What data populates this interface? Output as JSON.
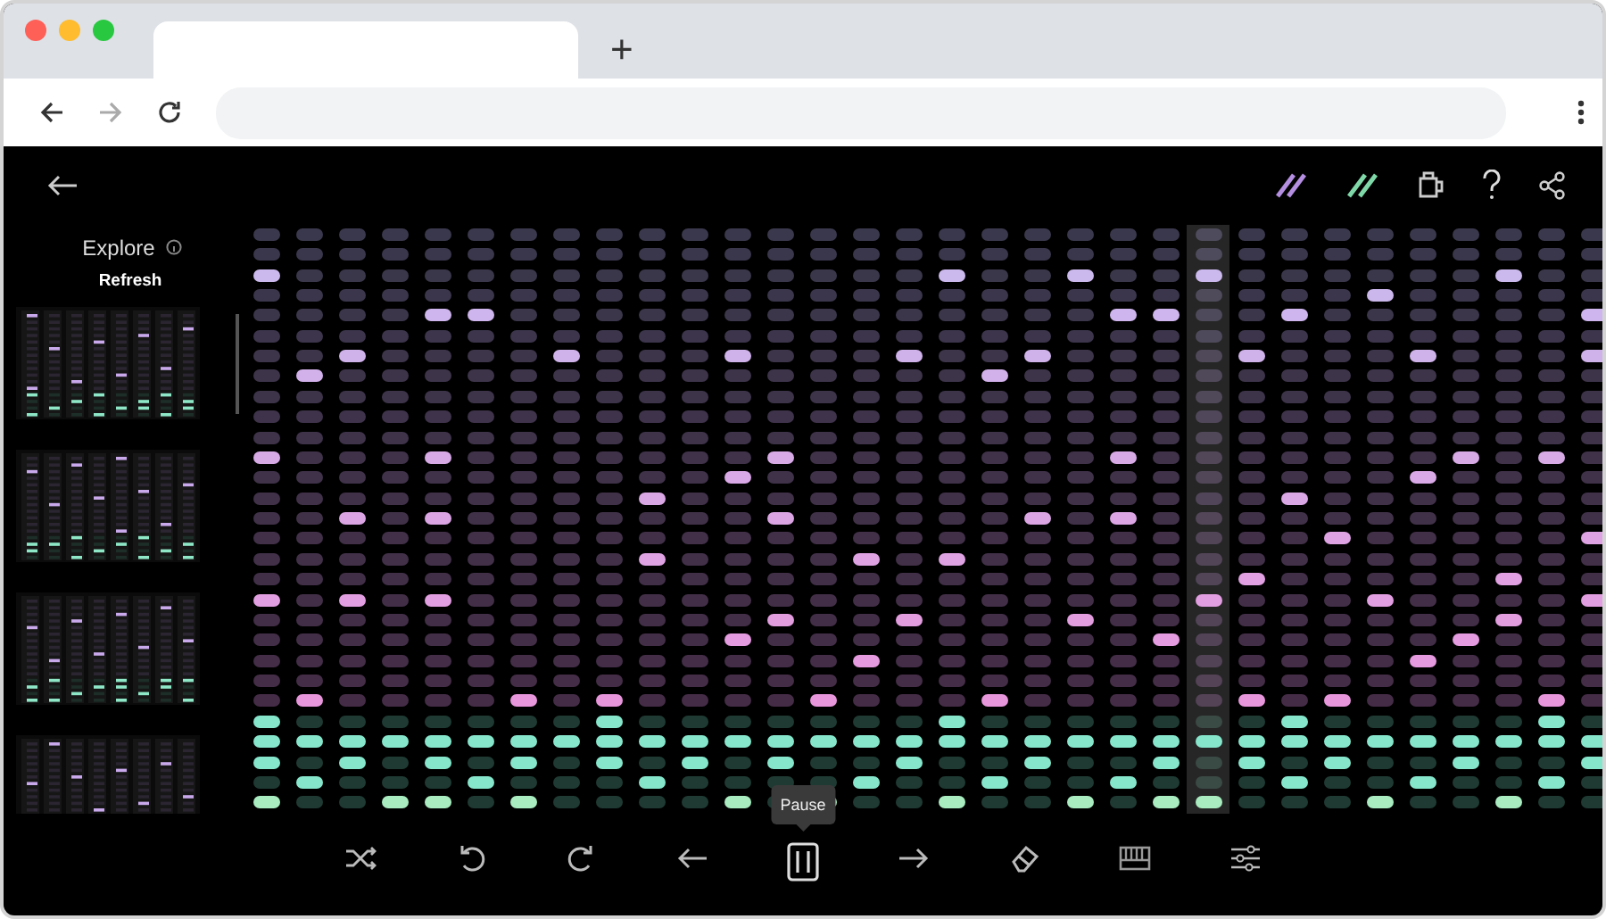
{
  "browser": {
    "new_tab": "+"
  },
  "sidebar": {
    "title": "Explore",
    "refresh": "Refresh",
    "previews": [
      {
        "kind": "pattern"
      },
      {
        "kind": "pattern"
      },
      {
        "kind": "pattern"
      },
      {
        "kind": "pattern"
      }
    ]
  },
  "sequencer": {
    "columns": [
      {
        "playing": false,
        "melody": [
          false,
          false,
          true,
          false,
          false,
          false,
          false,
          false,
          false,
          false,
          false,
          true,
          false,
          false,
          false,
          false,
          false,
          false,
          true,
          false,
          false,
          false,
          false,
          false
        ],
        "rhythm": [
          true,
          true,
          true,
          false,
          true
        ]
      },
      {
        "playing": false,
        "melody": [
          false,
          false,
          false,
          false,
          false,
          false,
          false,
          true,
          false,
          false,
          false,
          false,
          false,
          false,
          false,
          false,
          false,
          false,
          false,
          false,
          false,
          false,
          false,
          true
        ],
        "rhythm": [
          false,
          true,
          false,
          true,
          false
        ]
      },
      {
        "playing": false,
        "melody": [
          false,
          false,
          false,
          false,
          false,
          false,
          true,
          false,
          false,
          false,
          false,
          false,
          false,
          false,
          true,
          false,
          false,
          false,
          true,
          false,
          false,
          false,
          false,
          false
        ],
        "rhythm": [
          false,
          true,
          true,
          false,
          false
        ]
      },
      {
        "playing": false,
        "melody": [
          false,
          false,
          false,
          false,
          false,
          false,
          false,
          false,
          false,
          false,
          false,
          false,
          false,
          false,
          false,
          false,
          false,
          false,
          false,
          false,
          false,
          false,
          false,
          false
        ],
        "rhythm": [
          false,
          true,
          false,
          false,
          true
        ]
      },
      {
        "playing": false,
        "melody": [
          false,
          false,
          false,
          false,
          true,
          false,
          false,
          false,
          false,
          false,
          false,
          true,
          false,
          false,
          true,
          false,
          false,
          false,
          true,
          false,
          false,
          false,
          false,
          false
        ],
        "rhythm": [
          false,
          true,
          true,
          false,
          true
        ]
      },
      {
        "playing": false,
        "melody": [
          false,
          false,
          false,
          false,
          true,
          false,
          false,
          false,
          false,
          false,
          false,
          false,
          false,
          false,
          false,
          false,
          false,
          false,
          false,
          false,
          false,
          false,
          false,
          false
        ],
        "rhythm": [
          false,
          true,
          false,
          true,
          false
        ]
      },
      {
        "playing": false,
        "melody": [
          false,
          false,
          false,
          false,
          false,
          false,
          false,
          false,
          false,
          false,
          false,
          false,
          false,
          false,
          false,
          false,
          false,
          false,
          false,
          false,
          false,
          false,
          false,
          true
        ],
        "rhythm": [
          false,
          true,
          true,
          false,
          true
        ]
      },
      {
        "playing": false,
        "melody": [
          false,
          false,
          false,
          false,
          false,
          false,
          true,
          false,
          false,
          false,
          false,
          false,
          false,
          false,
          false,
          false,
          false,
          false,
          false,
          false,
          false,
          false,
          false,
          false
        ],
        "rhythm": [
          false,
          true,
          false,
          false,
          false
        ]
      },
      {
        "playing": false,
        "melody": [
          false,
          false,
          false,
          false,
          false,
          false,
          false,
          false,
          false,
          false,
          false,
          false,
          false,
          false,
          false,
          false,
          false,
          false,
          false,
          false,
          false,
          false,
          false,
          true
        ],
        "rhythm": [
          true,
          true,
          true,
          false,
          false
        ]
      },
      {
        "playing": false,
        "melody": [
          false,
          false,
          false,
          false,
          false,
          false,
          false,
          false,
          false,
          false,
          false,
          false,
          false,
          true,
          false,
          false,
          true,
          false,
          false,
          false,
          false,
          false,
          false,
          false
        ],
        "rhythm": [
          false,
          true,
          false,
          true,
          false
        ]
      },
      {
        "playing": false,
        "melody": [
          false,
          false,
          false,
          false,
          false,
          false,
          false,
          false,
          false,
          false,
          false,
          false,
          false,
          false,
          false,
          false,
          false,
          false,
          false,
          false,
          false,
          false,
          false,
          false
        ],
        "rhythm": [
          false,
          true,
          true,
          false,
          false
        ]
      },
      {
        "playing": false,
        "melody": [
          false,
          false,
          false,
          false,
          false,
          false,
          true,
          false,
          false,
          false,
          false,
          false,
          true,
          false,
          false,
          false,
          false,
          false,
          false,
          false,
          true,
          false,
          false,
          false
        ],
        "rhythm": [
          false,
          true,
          false,
          false,
          true
        ]
      },
      {
        "playing": false,
        "melody": [
          false,
          false,
          false,
          false,
          false,
          false,
          false,
          false,
          false,
          false,
          false,
          true,
          false,
          false,
          true,
          false,
          false,
          false,
          false,
          true,
          false,
          false,
          false,
          false
        ],
        "rhythm": [
          false,
          true,
          true,
          false,
          false
        ]
      },
      {
        "playing": false,
        "melody": [
          false,
          false,
          false,
          false,
          false,
          false,
          false,
          false,
          false,
          false,
          false,
          false,
          false,
          false,
          false,
          false,
          false,
          false,
          false,
          false,
          false,
          false,
          false,
          true
        ],
        "rhythm": [
          false,
          true,
          false,
          false,
          true
        ]
      },
      {
        "playing": false,
        "melody": [
          false,
          false,
          false,
          false,
          false,
          false,
          false,
          false,
          false,
          false,
          false,
          false,
          false,
          false,
          false,
          false,
          true,
          false,
          false,
          false,
          false,
          true,
          false,
          false
        ],
        "rhythm": [
          false,
          true,
          false,
          true,
          false
        ]
      },
      {
        "playing": false,
        "melody": [
          false,
          false,
          false,
          false,
          false,
          false,
          true,
          false,
          false,
          false,
          false,
          false,
          false,
          false,
          false,
          false,
          false,
          false,
          false,
          true,
          false,
          false,
          false,
          false
        ],
        "rhythm": [
          false,
          true,
          true,
          false,
          false
        ]
      },
      {
        "playing": false,
        "melody": [
          false,
          false,
          true,
          false,
          false,
          false,
          false,
          false,
          false,
          false,
          false,
          false,
          false,
          false,
          false,
          false,
          true,
          false,
          false,
          false,
          false,
          false,
          false,
          false
        ],
        "rhythm": [
          true,
          true,
          false,
          false,
          true
        ]
      },
      {
        "playing": false,
        "melody": [
          false,
          false,
          false,
          false,
          false,
          false,
          false,
          true,
          false,
          false,
          false,
          false,
          false,
          false,
          false,
          false,
          false,
          false,
          false,
          false,
          false,
          false,
          false,
          true
        ],
        "rhythm": [
          false,
          true,
          false,
          true,
          false
        ]
      },
      {
        "playing": false,
        "melody": [
          false,
          false,
          false,
          false,
          false,
          false,
          true,
          false,
          false,
          false,
          false,
          false,
          false,
          false,
          true,
          false,
          false,
          false,
          false,
          false,
          false,
          false,
          false,
          false
        ],
        "rhythm": [
          false,
          true,
          true,
          false,
          false
        ]
      },
      {
        "playing": false,
        "melody": [
          false,
          false,
          true,
          false,
          false,
          false,
          false,
          false,
          false,
          false,
          false,
          false,
          false,
          false,
          false,
          false,
          false,
          false,
          false,
          true,
          false,
          false,
          false,
          false
        ],
        "rhythm": [
          false,
          true,
          false,
          false,
          true
        ]
      },
      {
        "playing": false,
        "melody": [
          false,
          false,
          false,
          false,
          true,
          false,
          false,
          false,
          false,
          false,
          false,
          true,
          false,
          false,
          true,
          false,
          false,
          false,
          false,
          false,
          false,
          false,
          false,
          false
        ],
        "rhythm": [
          false,
          true,
          false,
          true,
          false
        ]
      },
      {
        "playing": false,
        "melody": [
          false,
          false,
          false,
          false,
          true,
          false,
          false,
          false,
          false,
          false,
          false,
          false,
          false,
          false,
          false,
          false,
          false,
          false,
          false,
          false,
          true,
          false,
          false,
          false
        ],
        "rhythm": [
          false,
          true,
          true,
          false,
          true
        ]
      },
      {
        "playing": true,
        "melody": [
          false,
          false,
          true,
          false,
          false,
          false,
          false,
          false,
          false,
          false,
          false,
          false,
          false,
          false,
          false,
          false,
          false,
          false,
          true,
          false,
          false,
          false,
          false,
          false
        ],
        "rhythm": [
          false,
          true,
          false,
          false,
          true
        ]
      },
      {
        "playing": false,
        "melody": [
          false,
          false,
          false,
          false,
          false,
          false,
          true,
          false,
          false,
          false,
          false,
          false,
          false,
          false,
          false,
          false,
          false,
          true,
          false,
          false,
          false,
          false,
          false,
          true
        ],
        "rhythm": [
          false,
          true,
          true,
          false,
          false
        ]
      },
      {
        "playing": false,
        "melody": [
          false,
          false,
          false,
          false,
          true,
          false,
          false,
          false,
          false,
          false,
          false,
          false,
          false,
          true,
          false,
          false,
          false,
          false,
          false,
          false,
          false,
          false,
          false,
          false
        ],
        "rhythm": [
          true,
          true,
          false,
          true,
          false
        ]
      },
      {
        "playing": false,
        "melody": [
          false,
          false,
          false,
          false,
          false,
          false,
          false,
          false,
          false,
          false,
          false,
          false,
          false,
          false,
          false,
          true,
          false,
          false,
          false,
          false,
          false,
          false,
          false,
          true
        ],
        "rhythm": [
          false,
          true,
          true,
          false,
          false
        ]
      },
      {
        "playing": false,
        "melody": [
          false,
          false,
          false,
          true,
          false,
          false,
          false,
          false,
          false,
          false,
          false,
          false,
          false,
          false,
          false,
          false,
          false,
          false,
          true,
          false,
          false,
          false,
          false,
          false
        ],
        "rhythm": [
          false,
          true,
          false,
          false,
          true
        ]
      },
      {
        "playing": false,
        "melody": [
          false,
          false,
          false,
          false,
          false,
          false,
          true,
          false,
          false,
          false,
          false,
          false,
          true,
          false,
          false,
          false,
          false,
          false,
          false,
          false,
          false,
          true,
          false,
          false
        ],
        "rhythm": [
          false,
          true,
          false,
          true,
          false
        ]
      },
      {
        "playing": false,
        "melody": [
          false,
          false,
          false,
          false,
          false,
          false,
          false,
          false,
          false,
          false,
          false,
          true,
          false,
          false,
          false,
          false,
          false,
          false,
          false,
          false,
          true,
          false,
          false,
          false
        ],
        "rhythm": [
          false,
          true,
          true,
          false,
          false
        ]
      },
      {
        "playing": false,
        "melody": [
          false,
          false,
          true,
          false,
          false,
          false,
          false,
          false,
          false,
          false,
          false,
          false,
          false,
          false,
          false,
          false,
          false,
          true,
          false,
          true,
          false,
          false,
          false,
          false
        ],
        "rhythm": [
          false,
          true,
          false,
          false,
          true
        ]
      },
      {
        "playing": false,
        "melody": [
          false,
          false,
          false,
          false,
          false,
          false,
          false,
          false,
          false,
          false,
          false,
          true,
          false,
          false,
          false,
          false,
          false,
          false,
          false,
          false,
          false,
          false,
          false,
          true
        ],
        "rhythm": [
          true,
          true,
          false,
          true,
          false
        ]
      },
      {
        "playing": false,
        "melody": [
          false,
          false,
          false,
          false,
          true,
          false,
          true,
          false,
          false,
          false,
          false,
          false,
          false,
          false,
          false,
          true,
          false,
          false,
          true,
          false,
          false,
          false,
          false,
          false
        ],
        "rhythm": [
          false,
          true,
          true,
          false,
          false
        ]
      }
    ]
  },
  "toolbar": {
    "buttons": [
      {
        "kind": "shuffle"
      },
      {
        "kind": "undo"
      },
      {
        "kind": "redo"
      },
      {
        "kind": "back"
      },
      {
        "kind": "pause",
        "tooltip": "Pause"
      },
      {
        "kind": "forward"
      },
      {
        "kind": "erase"
      },
      {
        "kind": "keyboard"
      },
      {
        "kind": "settings"
      }
    ]
  }
}
